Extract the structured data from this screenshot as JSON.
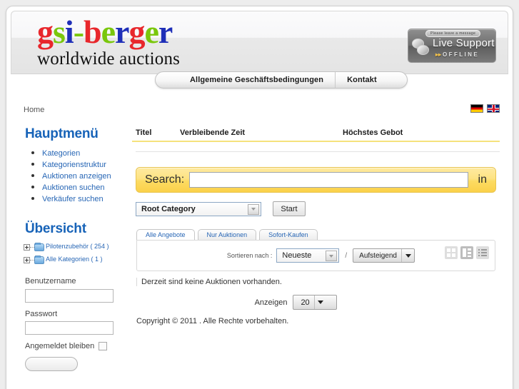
{
  "brand": {
    "logo_letters": [
      {
        "ch": "g",
        "color": "#e8272c"
      },
      {
        "ch": "s",
        "color": "#7ac70c"
      },
      {
        "ch": "i",
        "color": "#1f2fb8"
      },
      {
        "ch": "-",
        "color": "#7ac70c"
      },
      {
        "ch": "b",
        "color": "#e8272c"
      },
      {
        "ch": "e",
        "color": "#7ac70c"
      },
      {
        "ch": "r",
        "color": "#1f2fb8"
      },
      {
        "ch": "g",
        "color": "#e8272c"
      },
      {
        "ch": "e",
        "color": "#7ac70c"
      },
      {
        "ch": "r",
        "color": "#1f2fb8"
      }
    ],
    "tagline": "worldwide auctions"
  },
  "live_support": {
    "bubble": "Please leave a message",
    "title": "Live Support",
    "status": "OFFLINE",
    "arrows": "▸▸"
  },
  "nav": {
    "items": [
      {
        "label": "Allgemeine Geschäftsbedingungen"
      },
      {
        "label": "Kontakt"
      }
    ]
  },
  "breadcrumb": {
    "home": "Home"
  },
  "languages": [
    {
      "name": "german-flag"
    },
    {
      "name": "uk-flag"
    }
  ],
  "sidebar": {
    "main_menu_title": "Hauptmenü",
    "main_menu_items": [
      {
        "label": "Kategorien"
      },
      {
        "label": "Kategorienstruktur"
      },
      {
        "label": "Auktionen anzeigen"
      },
      {
        "label": "Auktionen suchen"
      },
      {
        "label": "Verkäufer suchen"
      }
    ],
    "overview_title": "Übersicht",
    "tree": [
      {
        "label": "Pilotenzubehör ( 254 )"
      },
      {
        "label": "Alle Kategorien ( 1 )"
      }
    ],
    "login": {
      "username_label": "Benutzername",
      "username_value": "",
      "password_label": "Passwort",
      "password_value": "",
      "remember_label": "Angemeldet bleiben",
      "submit_label": ""
    }
  },
  "main": {
    "columns": [
      {
        "label": "Titel"
      },
      {
        "label": "Verbleibende Zeit"
      },
      {
        "label": "Höchstes Gebot"
      }
    ],
    "search": {
      "label": "Search:",
      "value": "",
      "placeholder": "",
      "in_label": "in"
    },
    "category": {
      "selected": "Root Category",
      "start_label": "Start"
    },
    "tabs": [
      {
        "label": "Alle Angebote",
        "active": true
      },
      {
        "label": "Nur Auktionen",
        "active": false
      },
      {
        "label": "Sofort-Kaufen",
        "active": false
      }
    ],
    "sort": {
      "label": "Sortieren nach :",
      "field": "Neueste",
      "separator": "/",
      "direction": "Aufsteigend"
    },
    "view_modes": [
      {
        "name": "grid-view-icon",
        "active": false
      },
      {
        "name": "list-view-icon",
        "active": true
      },
      {
        "name": "compact-view-icon",
        "active": false
      }
    ],
    "empty_message": "Derzeit sind keine Auktionen vorhanden.",
    "per_page": {
      "label": "Anzeigen",
      "value": "20"
    },
    "copyright": "Copyright © 2011 . Alle Rechte vorbehalten."
  },
  "colors": {
    "link": "#2766b5",
    "heading": "#1763b8",
    "accent_yellow": "#fcdb62",
    "rule_yellow": "#f5e27c"
  }
}
